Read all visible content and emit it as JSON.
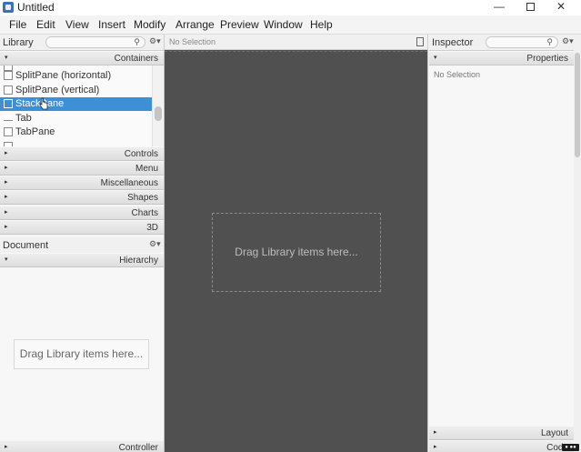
{
  "window": {
    "title": "Untitled",
    "minimize": "—",
    "close": "✕"
  },
  "menu": {
    "items": [
      "File",
      "Edit",
      "View",
      "Insert",
      "Modify",
      "Arrange",
      "Preview",
      "Window",
      "Help"
    ]
  },
  "library": {
    "title": "Library",
    "section_open": "Containers",
    "items": [
      {
        "label": "SplitPane  (horizontal)",
        "selected": false
      },
      {
        "label": "SplitPane  (vertical)",
        "selected": false
      },
      {
        "label": "StackPane",
        "selected": true
      },
      {
        "label": "Tab",
        "selected": false
      },
      {
        "label": "TabPane",
        "selected": false
      }
    ],
    "sections": [
      "Controls",
      "Menu",
      "Miscellaneous",
      "Shapes",
      "Charts",
      "3D"
    ]
  },
  "document": {
    "title": "Document",
    "section_open": "Hierarchy",
    "placeholder": "Drag Library items here...",
    "bottom_section": "Controller"
  },
  "canvas": {
    "header": "No Selection",
    "placeholder": "Drag Library items here..."
  },
  "inspector": {
    "title": "Inspector",
    "section_open": "Properties",
    "no_selection": "No Selection",
    "sections": [
      "Layout",
      "Code"
    ]
  },
  "icons": {
    "triangle_closed": "▸",
    "triangle_open": "▾",
    "search": "🔍",
    "gear": "⚙▾"
  },
  "colors": {
    "selection": "#3d8fd6",
    "canvas_bg": "#505050"
  }
}
